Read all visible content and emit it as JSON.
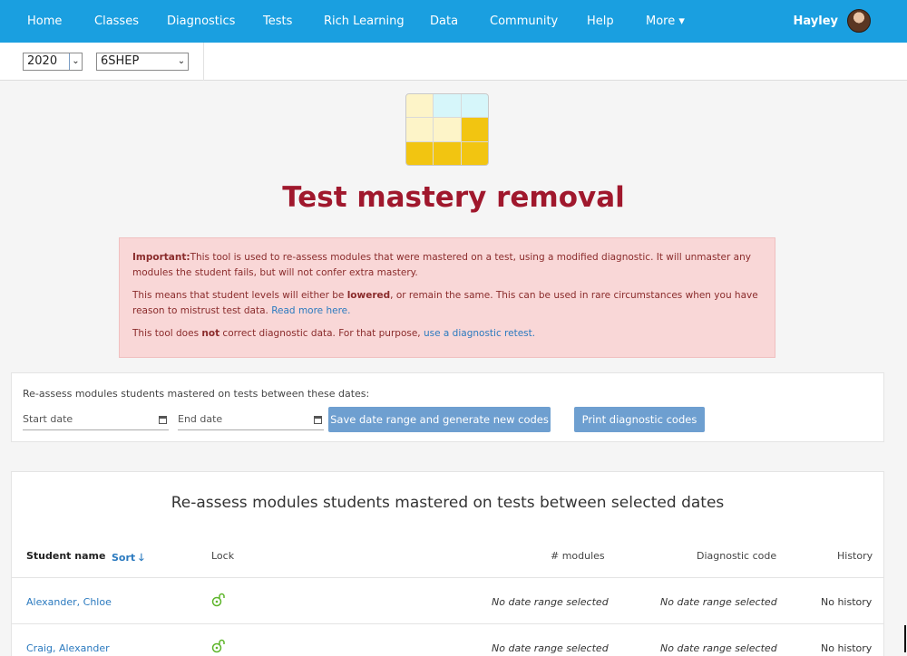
{
  "nav": {
    "items": [
      "Home",
      "Classes",
      "Diagnostics",
      "Tests",
      "Rich Learning",
      "Data",
      "Community",
      "Help",
      "More"
    ],
    "more_caret": "▾",
    "user_name": "Hayley"
  },
  "filters": {
    "year": "2020",
    "class": "6SHEP"
  },
  "logo": {
    "cell_colors": [
      "#fdf4c8",
      "#d6f6fa",
      "#d6f6fa",
      "#fdf4c8",
      "#fdf4c8",
      "#f2c511",
      "#f2c511",
      "#f2c511",
      "#f2c511"
    ]
  },
  "page_title": "Test mastery removal",
  "alert": {
    "p1_strong": "Important:",
    "p1_text": "This tool is used to re-assess modules that were mastered on a test, using a modified diagnostic. It will unmaster any modules the student fails, but will not confer extra mastery.",
    "p2_pre": "This means that student levels will either be ",
    "p2_strong": "lowered",
    "p2_post": ", or remain the same. This can be used in rare circumstances when you have reason to mistrust test data. ",
    "p2_link": "Read more here.",
    "p3_pre": "This tool does ",
    "p3_strong": "not",
    "p3_post": " correct diagnostic data. For that purpose, ",
    "p3_link": "use a diagnostic retest."
  },
  "dates": {
    "label": "Re-assess modules students mastered on tests between these dates:",
    "start_placeholder": "Start date",
    "end_placeholder": "End date",
    "save_button": "Save date range and generate new codes",
    "print_button": "Print diagnostic codes"
  },
  "table": {
    "title": "Re-assess modules students mastered on tests between selected dates",
    "headers": {
      "student_name": "Student name",
      "sort": "Sort",
      "sort_arrow": "🡓",
      "lock": "Lock",
      "modules": "# modules",
      "diagnostic_code": "Diagnostic code",
      "history": "History"
    },
    "rows": [
      {
        "name": "Alexander, Chloe",
        "modules": "No date range selected",
        "code": "No date range selected",
        "history": "No history"
      },
      {
        "name": "Craig, Alexander",
        "modules": "No date range selected",
        "code": "No date range selected",
        "history": "No history"
      }
    ]
  },
  "colors": {
    "nav_bg": "#1a9fe0",
    "title": "#a0182d",
    "alert_bg": "#f9d7d7",
    "button": "#6e9fd0",
    "link": "#2b7abf",
    "lock_icon": "#5db52a"
  }
}
